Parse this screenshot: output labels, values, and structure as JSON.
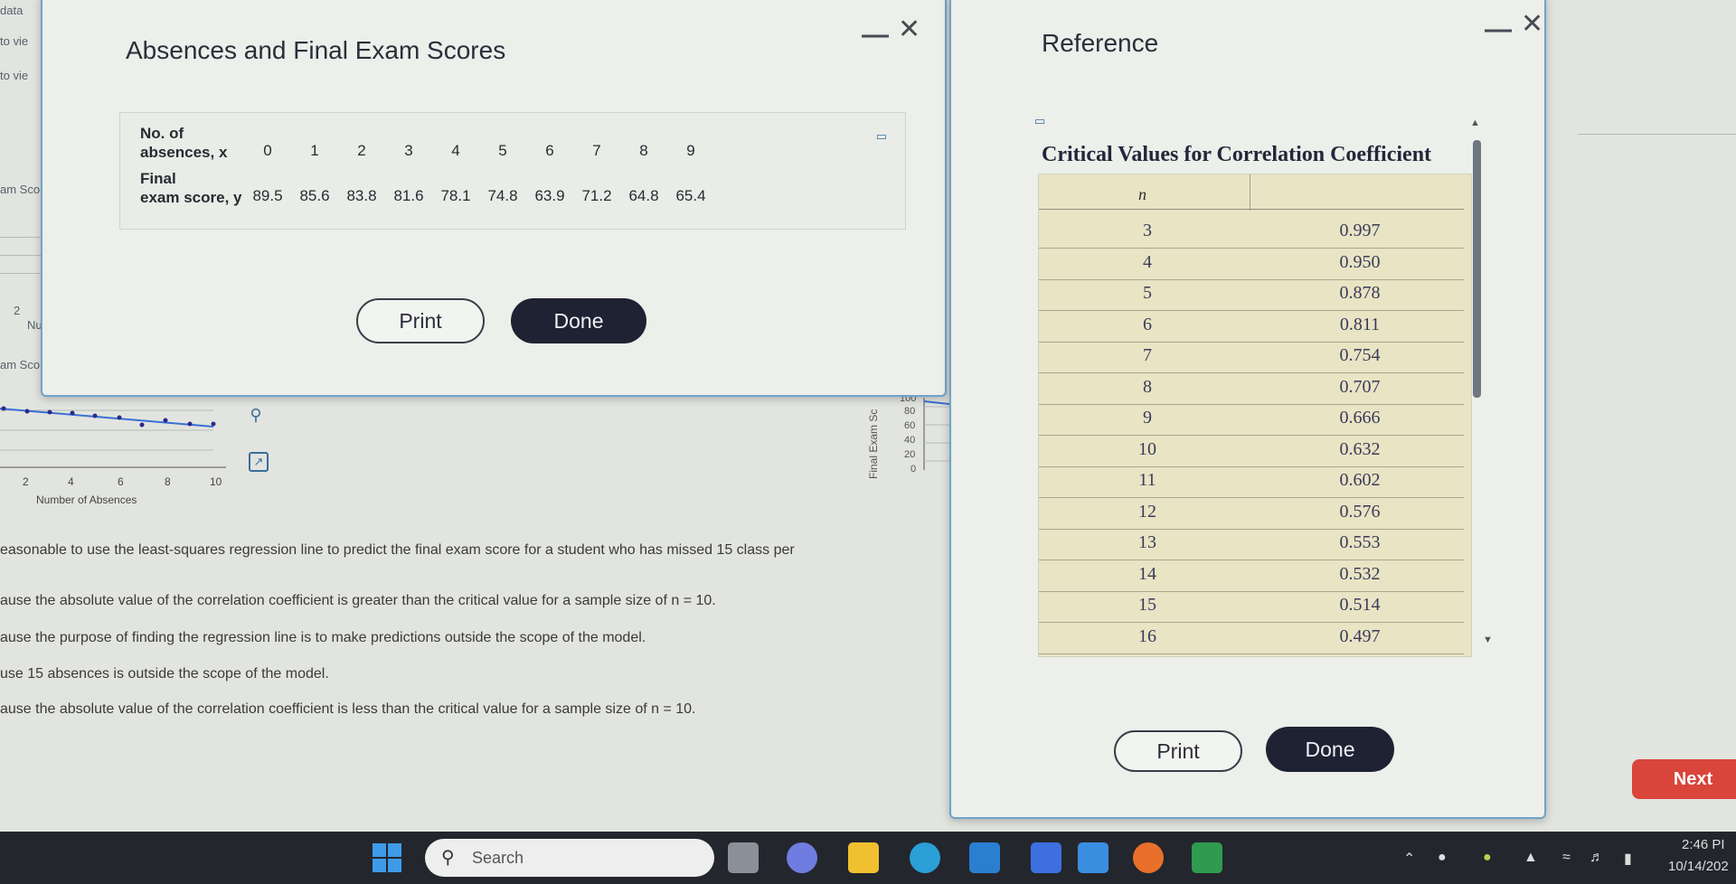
{
  "background": {
    "left_fragments": [
      "data",
      "to vie",
      "to vie",
      "am Sco",
      "2",
      "Nur",
      "am Sco"
    ],
    "mini_chart": {
      "x_ticks": [
        "2",
        "4",
        "6",
        "8",
        "10"
      ],
      "xlabel": "Number of Absences"
    },
    "small_chart": {
      "ylabel": "Final Exam Sc",
      "y_ticks": [
        "100",
        "80",
        "60",
        "40",
        "20",
        "0"
      ]
    },
    "question": "easonable to use the least-squares regression line to predict the final exam score for a student who has missed 15 class per",
    "options": [
      "ause the absolute value of the correlation coefficient is greater than the critical value for a sample size of n = 10.",
      "ause the purpose of finding the regression line is to make predictions outside the scope of the model.",
      "use 15 absences is outside the scope of the model.",
      "ause the absolute value of the correlation coefficient is less than the critical value for a sample size of n = 10."
    ],
    "next_label": "Next"
  },
  "data_dialog": {
    "title": "Absences and Final Exam Scores",
    "minimize": "—",
    "close": "✕",
    "row_x_label_1": "No. of",
    "row_x_label_2": "absences, x",
    "row_y_label_1": "Final",
    "row_y_label_2": "exam score, y",
    "x_values": [
      "0",
      "1",
      "2",
      "3",
      "4",
      "5",
      "6",
      "7",
      "8",
      "9"
    ],
    "y_values": [
      "89.5",
      "85.6",
      "83.8",
      "81.6",
      "78.1",
      "74.8",
      "63.9",
      "71.2",
      "64.8",
      "65.4"
    ],
    "print_label": "Print",
    "done_label": "Done"
  },
  "reference_dialog": {
    "title": "Reference",
    "minimize": "—",
    "close": "✕",
    "table_title": "Critical Values for Correlation Coefficient",
    "col_n": "n",
    "rows": [
      {
        "n": "3",
        "v": "0.997"
      },
      {
        "n": "4",
        "v": "0.950"
      },
      {
        "n": "5",
        "v": "0.878"
      },
      {
        "n": "6",
        "v": "0.811"
      },
      {
        "n": "7",
        "v": "0.754"
      },
      {
        "n": "8",
        "v": "0.707"
      },
      {
        "n": "9",
        "v": "0.666"
      },
      {
        "n": "10",
        "v": "0.632"
      },
      {
        "n": "11",
        "v": "0.602"
      },
      {
        "n": "12",
        "v": "0.576"
      },
      {
        "n": "13",
        "v": "0.553"
      },
      {
        "n": "14",
        "v": "0.532"
      },
      {
        "n": "15",
        "v": "0.514"
      },
      {
        "n": "16",
        "v": "0.497"
      }
    ],
    "print_label": "Print",
    "done_label": "Done"
  },
  "taskbar": {
    "search_label": "Search",
    "time": "2:46 PI",
    "date": "10/14/202"
  }
}
